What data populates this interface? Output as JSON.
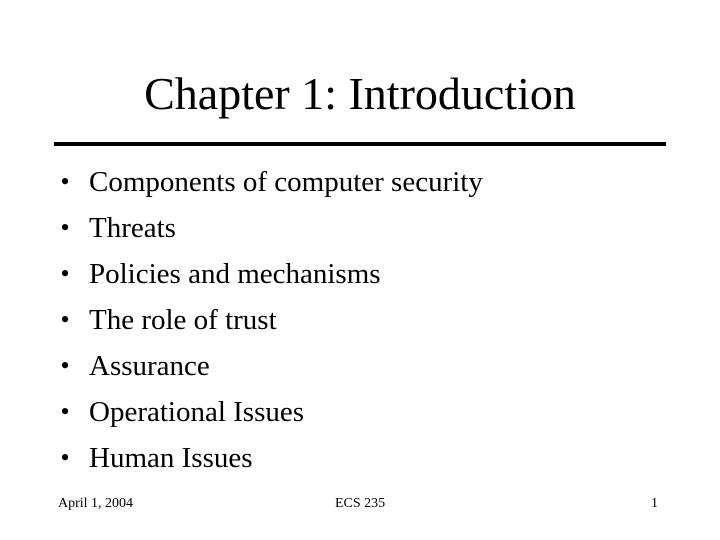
{
  "slide": {
    "title": "Chapter 1: Introduction",
    "bullet_glyph": "•",
    "bullets": [
      "Components of computer security",
      "Threats",
      "Policies and mechanisms",
      "The role of trust",
      "Assurance",
      "Operational Issues",
      "Human Issues"
    ]
  },
  "footer": {
    "date": "April 1, 2004",
    "course": "ECS 235",
    "page_number": "1"
  }
}
